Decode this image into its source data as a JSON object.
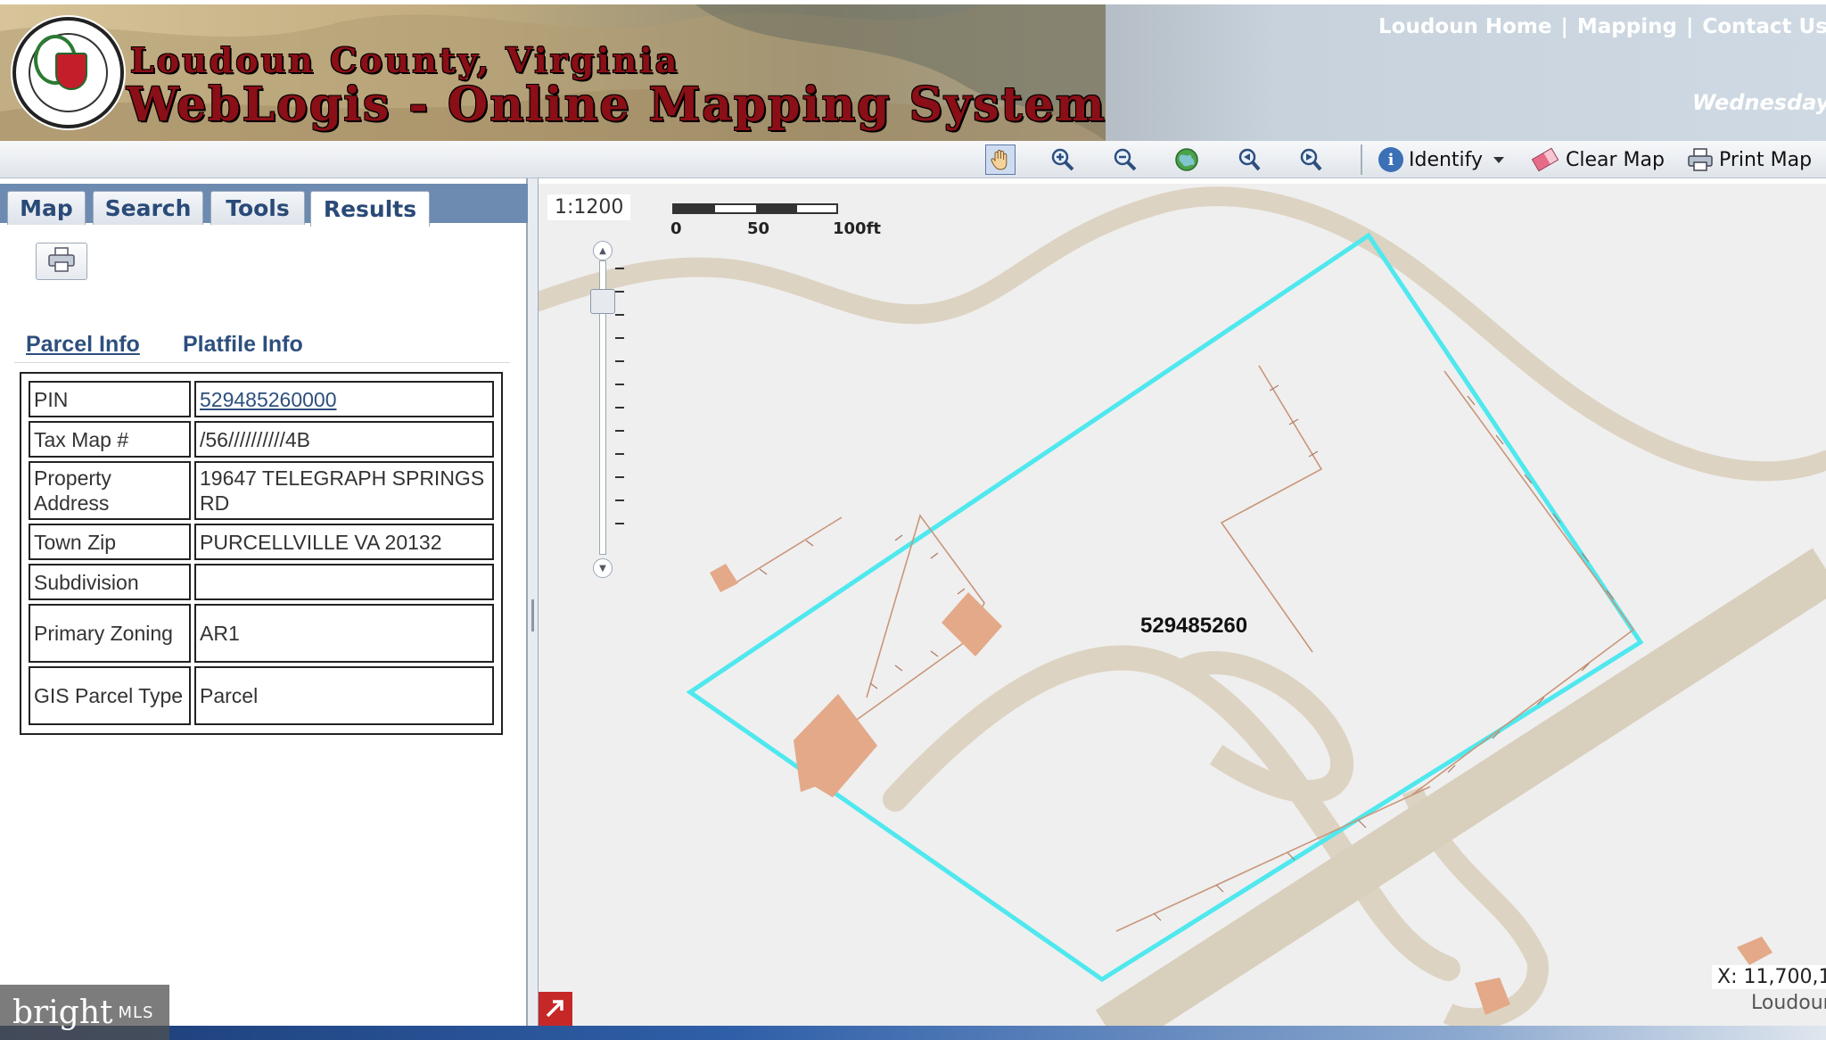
{
  "header": {
    "title_line1": "Loudoun County, Virginia",
    "title_line2": "WebLogis - Online Mapping System",
    "links": [
      "Loudoun Home",
      "Mapping",
      "Contact Us"
    ],
    "link_separator": "|",
    "link_partial": "H",
    "date_text": "Wednesday, "
  },
  "toolbar": {
    "identify_label": "Identify",
    "clear_map_label": "Clear Map",
    "print_map_label": "Print Map",
    "icons": [
      "pan-hand-icon",
      "zoom-in-icon",
      "zoom-out-icon",
      "full-extent-globe-icon",
      "previous-extent-icon",
      "next-extent-icon",
      "info-icon",
      "eraser-icon",
      "printer-icon"
    ]
  },
  "tabs": [
    {
      "label": "Map",
      "active": false
    },
    {
      "label": "Search",
      "active": false
    },
    {
      "label": "Tools",
      "active": false
    },
    {
      "label": "Results",
      "active": true
    }
  ],
  "results": {
    "parcel_info_link": "Parcel Info",
    "platfile_info_link": "Platfile Info",
    "rows": [
      {
        "key": "PIN",
        "value": "529485260000",
        "is_link": true
      },
      {
        "key": "Tax Map #",
        "value": "/56//////////4B"
      },
      {
        "key": "Property Address",
        "value": "19647 TELEGRAPH SPRINGS RD"
      },
      {
        "key": "Town Zip",
        "value": "PURCELLVILLE VA 20132"
      },
      {
        "key": "Subdivision",
        "value": ""
      },
      {
        "key": "Primary Zoning",
        "value": "AR1"
      },
      {
        "key": "GIS Parcel Type",
        "value": "Parcel"
      }
    ]
  },
  "map": {
    "scale_ratio": "1:1200",
    "scalebar_labels": [
      "0",
      "50",
      "100ft"
    ],
    "parcel_label": "529485260",
    "coordinate_readout": "X: 11,700,1",
    "attribution": "Loudoun",
    "colors": {
      "background": "#efefef",
      "road": "#ddd3c2",
      "parcel_outline": "#4fe8ee",
      "building": "#e3a988",
      "fence": "#c9967a"
    }
  },
  "watermark": {
    "brand": "bright",
    "suffix": "MLS"
  }
}
